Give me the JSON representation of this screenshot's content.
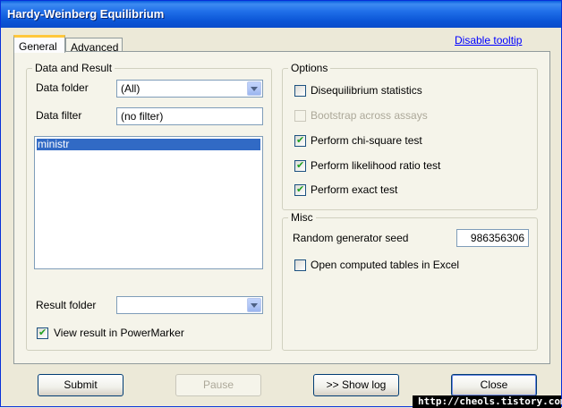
{
  "window": {
    "title": "Hardy-Weinberg Equilibrium"
  },
  "tabs": [
    {
      "label": "General",
      "active": true
    },
    {
      "label": "Advanced",
      "active": false
    }
  ],
  "tooltip_link": "Disable tooltip",
  "data_result": {
    "legend": "Data and Result",
    "data_folder_label": "Data folder",
    "data_folder_value": "(All)",
    "data_filter_label": "Data filter",
    "data_filter_value": "(no filter)",
    "list_items": [
      "ministr"
    ],
    "result_folder_label": "Result folder",
    "result_folder_value": "",
    "view_result_label": "View result in PowerMarker",
    "view_result_checked": true
  },
  "options": {
    "legend": "Options",
    "items": [
      {
        "label": "Disequilibrium statistics",
        "checked": false,
        "enabled": true
      },
      {
        "label": "Bootstrap across assays",
        "checked": false,
        "enabled": false
      },
      {
        "label": "Perform chi-square test",
        "checked": true,
        "enabled": true
      },
      {
        "label": "Perform likelihood ratio test",
        "checked": true,
        "enabled": true
      },
      {
        "label": "Perform exact test",
        "checked": true,
        "enabled": true
      }
    ]
  },
  "misc": {
    "legend": "Misc",
    "seed_label": "Random generator seed",
    "seed_value": "986356306",
    "excel_label": "Open computed tables in Excel",
    "excel_checked": false
  },
  "buttons": {
    "submit": "Submit",
    "pause": "Pause",
    "show_log": ">> Show log",
    "close": "Close"
  },
  "watermark": "http://cheols.tistory.com"
}
